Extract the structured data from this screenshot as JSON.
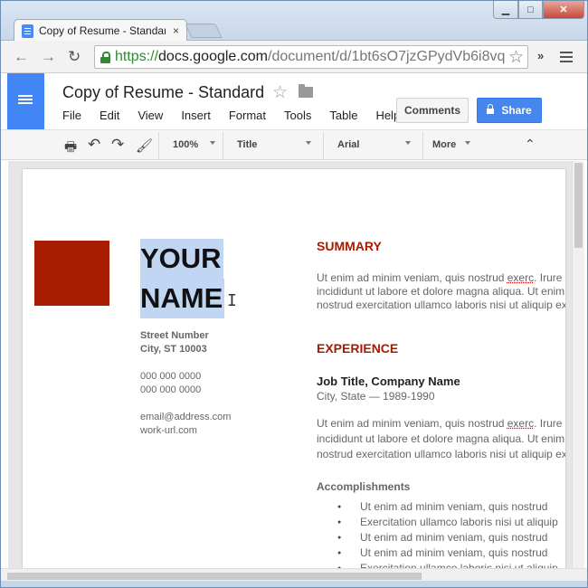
{
  "browser": {
    "tab_title": "Copy of Resume - Standard",
    "tab_close": "×",
    "url_scheme": "https://",
    "url_host": "docs.google.com",
    "url_path": "/document/d/1bt6sO7jzGPydVb6i8vq",
    "ext_chevron": "»",
    "nav_back": "←",
    "nav_forward": "→",
    "reload": "↻",
    "star": "☆",
    "min": "▁",
    "max": "□",
    "close": "✕"
  },
  "docs": {
    "title": "Copy of Resume - Standard",
    "title_star": "☆",
    "menu": [
      "File",
      "Edit",
      "View",
      "Insert",
      "Format",
      "Tools",
      "Table",
      "Help"
    ],
    "comments_label": "Comments",
    "share_label": "Share",
    "toolbar": {
      "print": "🖶",
      "undo": "↶",
      "redo": "↷",
      "paint": "🖌",
      "zoom": "100%",
      "style": "Title",
      "font": "Arial",
      "more": "More",
      "collapse": "⌃"
    }
  },
  "resume": {
    "name_line1": "YOUR",
    "name_line2": "NAME",
    "ibeam": "I",
    "street": "Street Number",
    "city": "City, ST 10003",
    "phone1": "000 000 0000",
    "phone2": "000 000 0000",
    "email": "email@address.com",
    "website": "work-url.com",
    "summary_heading": "SUMMARY",
    "summary_l1a": "Ut enim ad minim veniam, quis nostrud ",
    "summary_l1b": "exerc",
    "summary_l1c": ". Irure dolor in reprehend",
    "summary_l2": "incididunt ut labore et dolore magna aliqua. Ut enim ad minim",
    "summary_l3": "nostrud exercitation ullamco laboris nisi ut aliquip ex ea commodo",
    "experience_heading": "EXPERIENCE",
    "job_title": "Job Title, Company Name",
    "job_sub": "City, State — 1989-1990",
    "exp_l1a": "Ut enim ad minim veniam, quis nostrud ",
    "exp_l1b": "exerc",
    "exp_l1c": ". Irure dolor in reprehend",
    "exp_l2": "incididunt ut labore et dolore magna aliqua. Ut enim ad minim",
    "exp_l3": "nostrud exercitation ullamco laboris nisi ut aliquip ex ea commodo",
    "accomplishments_heading": "Accomplishments",
    "bullets": [
      "Ut enim ad minim veniam, quis nostrud",
      "Exercitation ullamco laboris nisi ut aliquip",
      "Ut enim ad minim veniam, quis nostrud",
      "Ut enim ad minim veniam, quis nostrud",
      "Exercitation ullamco laboris nisi ut aliquip"
    ]
  },
  "colors": {
    "accent_red": "#a61c00",
    "docs_blue": "#4285f4",
    "share_blue": "#4787ed",
    "selection": "#c1d6f3"
  }
}
